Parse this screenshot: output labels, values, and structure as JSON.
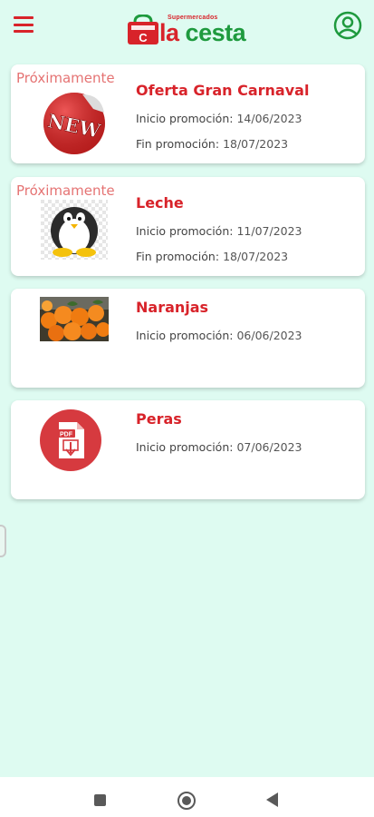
{
  "header": {
    "logo_small_text": "Supermercados",
    "logo_main_la": "la",
    "logo_main_cesta": "cesta",
    "logo_letter": "C"
  },
  "promotions": [
    {
      "badge": "Próximamente",
      "title": "Oferta Gran Carnaval",
      "start_label": "Inicio promoción:",
      "start_date": "14/06/2023",
      "end_label": "Fin promoción:",
      "end_date": "18/07/2023",
      "image_icon": "new-sticker-image",
      "image_text": "NEW"
    },
    {
      "badge": "Próximamente",
      "title": "Leche",
      "start_label": "Inicio promoción:",
      "start_date": "11/07/2023",
      "end_label": "Fin promoción:",
      "end_date": "18/07/2023",
      "image_icon": "penguin-image"
    },
    {
      "title": "Naranjas",
      "start_label": "Inicio promoción:",
      "start_date": "06/06/2023",
      "image_icon": "oranges-image"
    },
    {
      "title": "Peras",
      "start_label": "Inicio promoción:",
      "start_date": "07/06/2023",
      "image_icon": "pdf-icon",
      "image_text": "PDF"
    }
  ],
  "colors": {
    "background": "#defbf1",
    "accent_red": "#d8232a",
    "brand_green": "#1e9a3e",
    "badge_pink": "#e57373"
  },
  "navbar": {
    "icons": [
      "recent-apps-icon",
      "home-icon",
      "back-icon"
    ]
  }
}
